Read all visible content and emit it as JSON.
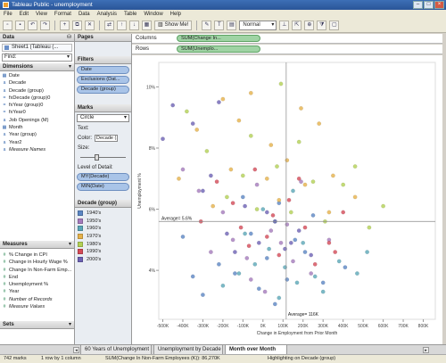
{
  "window": {
    "title": "Tableau Public - unemployment"
  },
  "menu": [
    "File",
    "Edit",
    "View",
    "Format",
    "Data",
    "Analysis",
    "Table",
    "Window",
    "Help"
  ],
  "toolbar": {
    "show_me": "Show Me!",
    "fit_select": "Normal"
  },
  "data_pane": {
    "header": "Data",
    "source": "Sheet1 (Tableau (...",
    "find": "Find:",
    "dimensions_header": "Dimensions",
    "dimensions": [
      {
        "icon": "calendar",
        "label": "Date",
        "italic": false
      },
      {
        "icon": "abc",
        "label": "Decade",
        "italic": false
      },
      {
        "icon": "abc",
        "label": "Decade (group)",
        "italic": false
      },
      {
        "icon": "calc",
        "label": "fxDecade (group)0",
        "italic": false
      },
      {
        "icon": "calc",
        "label": "fxYear (group)0",
        "italic": false
      },
      {
        "icon": "calc",
        "label": "fxYear0",
        "italic": false
      },
      {
        "icon": "abc",
        "label": "Job Openings (M)",
        "italic": false
      },
      {
        "icon": "calendar",
        "label": "Month",
        "italic": false
      },
      {
        "icon": "abc",
        "label": "Year (group)",
        "italic": false
      },
      {
        "icon": "abc",
        "label": "Year2",
        "italic": false
      },
      {
        "icon": "abc",
        "label": "Measure Names",
        "italic": true
      }
    ],
    "measures_header": "Measures",
    "measures": [
      {
        "label": "% Change in CPI",
        "italic": false
      },
      {
        "label": "Change in Hourly Wage %",
        "italic": false
      },
      {
        "label": "Change In Non-Farm Emp...",
        "italic": false
      },
      {
        "label": "End",
        "italic": false
      },
      {
        "label": "Unemployment %",
        "italic": false
      },
      {
        "label": "Year",
        "italic": false
      },
      {
        "label": "Number of Records",
        "italic": true
      },
      {
        "label": "Measure Values",
        "italic": true
      }
    ],
    "sets_header": "Sets"
  },
  "pages_header": "Pages",
  "filters": {
    "header": "Filters",
    "items": [
      "Date",
      "Exclusions (Dat...",
      "Decade (group)"
    ]
  },
  "marks": {
    "header": "Marks",
    "type": "Circle",
    "text_label": "Text:",
    "color_label": "Color:",
    "color_value": "Decade (...",
    "size_label": "Size:",
    "lod_label": "Level of Detail:",
    "lod_items": [
      "MY(Decade)",
      "MIN(Date)"
    ]
  },
  "legend": {
    "header": "Decade (group)",
    "items": [
      {
        "label": "1940's",
        "color": "#5b86c4"
      },
      {
        "label": "1950's",
        "color": "#a57bbd"
      },
      {
        "label": "1960's",
        "color": "#5aa7b8"
      },
      {
        "label": "1970's",
        "color": "#e6b24a"
      },
      {
        "label": "1980's",
        "color": "#b3d154"
      },
      {
        "label": "1990's",
        "color": "#d54a57"
      },
      {
        "label": "2000's",
        "color": "#6d62b5"
      }
    ]
  },
  "shelves": {
    "columns_label": "Columns",
    "columns_pill": "SUM(Change In...",
    "rows_label": "Rows",
    "rows_pill": "SUM(Unemplo..."
  },
  "chart_data": {
    "type": "scatter",
    "xlabel": "Change in Employment from Prior Month",
    "ylabel": "Unemployment %",
    "x_ticks": [
      "-500K",
      "-400K",
      "-300K",
      "-200K",
      "-100K",
      "0K",
      "100K",
      "200K",
      "300K",
      "400K",
      "500K",
      "600K",
      "700K",
      "800K"
    ],
    "y_ticks": [
      "10%",
      "8%",
      "6%",
      "4%"
    ],
    "xlim": [
      -520000,
      860000
    ],
    "ylim": [
      2.4,
      10.8
    ],
    "reference_lines": [
      {
        "axis": "y",
        "value": 5.6,
        "label": "Average= 5.6%"
      },
      {
        "axis": "x",
        "value": 116000,
        "label": "Average= 116K"
      }
    ],
    "series": [
      {
        "name": "1940's",
        "color": "#5b86c4",
        "points": [
          [
            -300000,
            3.2
          ],
          [
            -140000,
            3.9
          ],
          [
            20000,
            4.4
          ],
          [
            120000,
            3.7
          ],
          [
            -60000,
            5.2
          ],
          [
            210000,
            4.6
          ],
          [
            -220000,
            4.2
          ],
          [
            60000,
            2.9
          ],
          [
            300000,
            3.6
          ],
          [
            -20000,
            3.4
          ],
          [
            -350000,
            3.8
          ],
          [
            160000,
            5.0
          ],
          [
            410000,
            4.1
          ],
          [
            -100000,
            6.4
          ],
          [
            250000,
            5.8
          ],
          [
            80000,
            6.2
          ],
          [
            -400000,
            5.1
          ]
        ]
      },
      {
        "name": "1950's",
        "color": "#a57bbd",
        "points": [
          [
            -200000,
            5.9
          ],
          [
            -80000,
            4.4
          ],
          [
            40000,
            5.3
          ],
          [
            150000,
            4.3
          ],
          [
            -320000,
            6.6
          ],
          [
            240000,
            3.9
          ],
          [
            -30000,
            6.8
          ],
          [
            90000,
            4.9
          ],
          [
            330000,
            5.0
          ],
          [
            -150000,
            5.0
          ],
          [
            -260000,
            4.6
          ],
          [
            10000,
            3.3
          ],
          [
            190000,
            6.9
          ],
          [
            -400000,
            7.3
          ],
          [
            120000,
            5.5
          ],
          [
            -60000,
            3.7
          ]
        ]
      },
      {
        "name": "1960's",
        "color": "#5aa7b8",
        "points": [
          [
            -120000,
            3.9
          ],
          [
            30000,
            4.7
          ],
          [
            170000,
            3.6
          ],
          [
            260000,
            3.8
          ],
          [
            60000,
            5.6
          ],
          [
            -40000,
            4.2
          ],
          [
            380000,
            4.3
          ],
          [
            110000,
            4.1
          ],
          [
            200000,
            4.9
          ],
          [
            -90000,
            5.2
          ],
          [
            470000,
            3.9
          ],
          [
            0,
            6.0
          ],
          [
            150000,
            6.6
          ],
          [
            300000,
            3.3
          ],
          [
            -200000,
            3.5
          ],
          [
            80000,
            3.1
          ],
          [
            520000,
            4.6
          ]
        ]
      },
      {
        "name": "1970's",
        "color": "#e6b24a",
        "points": [
          [
            -330000,
            8.6
          ],
          [
            -160000,
            7.3
          ],
          [
            40000,
            8.1
          ],
          [
            210000,
            6.8
          ],
          [
            120000,
            7.6
          ],
          [
            -250000,
            6.1
          ],
          [
            350000,
            7.1
          ],
          [
            -60000,
            9.8
          ],
          [
            280000,
            8.8
          ],
          [
            -420000,
            7.0
          ],
          [
            80000,
            6.3
          ],
          [
            190000,
            9.3
          ],
          [
            -120000,
            8.9
          ],
          [
            460000,
            6.4
          ],
          [
            20000,
            7.0
          ],
          [
            -200000,
            9.6
          ],
          [
            330000,
            5.9
          ]
        ]
      },
      {
        "name": "1980's",
        "color": "#b3d154",
        "points": [
          [
            -280000,
            7.9
          ],
          [
            -100000,
            7.1
          ],
          [
            70000,
            7.4
          ],
          [
            250000,
            6.9
          ],
          [
            140000,
            5.9
          ],
          [
            -180000,
            6.4
          ],
          [
            400000,
            6.8
          ],
          [
            -30000,
            6.0
          ],
          [
            310000,
            5.6
          ],
          [
            530000,
            5.4
          ],
          [
            -380000,
            9.2
          ],
          [
            180000,
            8.2
          ],
          [
            -60000,
            8.4
          ],
          [
            90000,
            10.1
          ],
          [
            460000,
            7.4
          ],
          [
            600000,
            6.1
          ]
        ]
      },
      {
        "name": "1990's",
        "color": "#d54a57",
        "points": [
          [
            -230000,
            6.9
          ],
          [
            -110000,
            5.4
          ],
          [
            50000,
            5.8
          ],
          [
            210000,
            5.4
          ],
          [
            330000,
            4.9
          ],
          [
            -40000,
            7.3
          ],
          [
            130000,
            6.3
          ],
          [
            260000,
            4.2
          ],
          [
            -310000,
            5.6
          ],
          [
            80000,
            4.5
          ],
          [
            400000,
            5.9
          ],
          [
            -150000,
            6.2
          ],
          [
            180000,
            7.0
          ],
          [
            20000,
            5.1
          ],
          [
            360000,
            4.6
          ],
          [
            -70000,
            4.8
          ]
        ]
      },
      {
        "name": "2000's",
        "color": "#6d62b5",
        "points": [
          [
            -450000,
            9.4
          ],
          [
            -350000,
            8.8
          ],
          [
            -260000,
            7.1
          ],
          [
            -180000,
            5.2
          ],
          [
            -90000,
            6.1
          ],
          [
            20000,
            5.9
          ],
          [
            110000,
            4.7
          ],
          [
            180000,
            5.3
          ],
          [
            -20000,
            4.9
          ],
          [
            240000,
            4.5
          ],
          [
            -140000,
            4.6
          ],
          [
            60000,
            5.6
          ],
          [
            -300000,
            6.6
          ],
          [
            140000,
            4.9
          ],
          [
            -500000,
            8.3
          ],
          [
            -220000,
            9.5
          ]
        ]
      }
    ]
  },
  "tabs": [
    {
      "label": "60 Years of Unemployment",
      "active": false
    },
    {
      "label": "Unemployment by Decade",
      "active": false
    },
    {
      "label": "Month over Month",
      "active": true
    }
  ],
  "status": {
    "marks": "742 marks",
    "rows": "1 row by 1 column",
    "sum": "SUM(Change In Non-Farm Employees (K)): 86,270K",
    "highlight": "Highlighting on Decade (group)"
  }
}
